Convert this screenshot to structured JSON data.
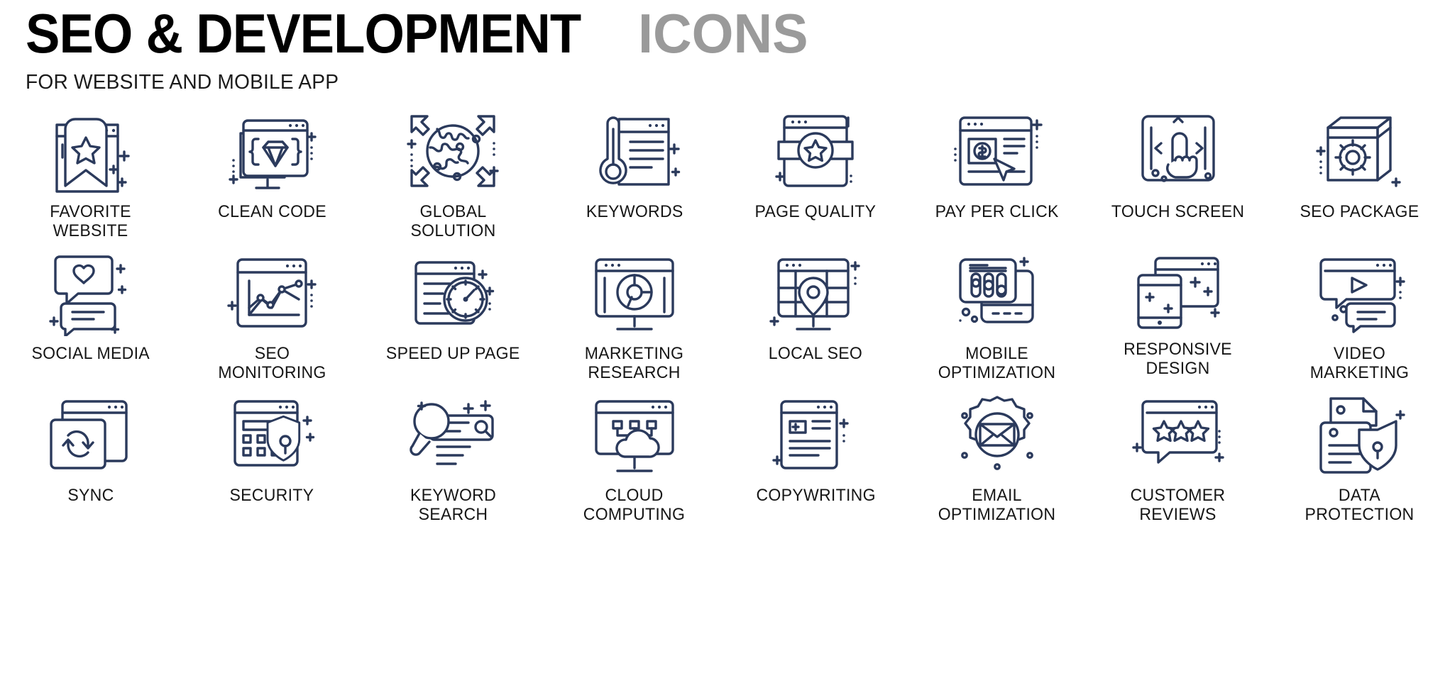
{
  "header": {
    "title_main": "SEO & DEVELOPMENT",
    "title_accent": "ICONS",
    "subtitle": "FOR WEBSITE AND MOBILE APP"
  },
  "colors": {
    "icon_stroke": "#2B3A5C",
    "title": "#000000",
    "title_accent": "#9A9A9A",
    "label": "#161616",
    "background": "#FFFFFF"
  },
  "grid": {
    "columns": 8,
    "rows": 3
  },
  "icons": [
    {
      "id": "favorite-website",
      "label": "FAVORITE WEBSITE",
      "row": 1,
      "col": 1
    },
    {
      "id": "clean-code",
      "label": "CLEAN CODE",
      "row": 1,
      "col": 2
    },
    {
      "id": "global-solution",
      "label": "GLOBAL SOLUTION",
      "row": 1,
      "col": 3
    },
    {
      "id": "keywords",
      "label": "KEYWORDS",
      "row": 1,
      "col": 4
    },
    {
      "id": "page-quality",
      "label": "PAGE QUALITY",
      "row": 1,
      "col": 5
    },
    {
      "id": "pay-per-click",
      "label": "PAY PER CLICK",
      "row": 1,
      "col": 6
    },
    {
      "id": "touch-screen",
      "label": "TOUCH SCREEN",
      "row": 1,
      "col": 7
    },
    {
      "id": "seo-package",
      "label": "SEO PACKAGE",
      "row": 1,
      "col": 8
    },
    {
      "id": "social-media",
      "label": "SOCIAL MEDIA",
      "row": 2,
      "col": 1
    },
    {
      "id": "seo-monitoring",
      "label": "SEO MONITORING",
      "row": 2,
      "col": 2
    },
    {
      "id": "speed-up-page",
      "label": "SPEED UP PAGE",
      "row": 2,
      "col": 3
    },
    {
      "id": "marketing-research",
      "label": "MARKETING RESEARCH",
      "row": 2,
      "col": 4
    },
    {
      "id": "local-seo",
      "label": "LOCAL SEO",
      "row": 2,
      "col": 5
    },
    {
      "id": "mobile-optimization",
      "label": "MOBILE OPTIMIZATION",
      "row": 2,
      "col": 6
    },
    {
      "id": "responsive-design",
      "label": "RESPONSIVE DESIGN",
      "row": 2,
      "col": 7
    },
    {
      "id": "video-marketing",
      "label": "VIDEO MARKETING",
      "row": 2,
      "col": 8
    },
    {
      "id": "sync",
      "label": "SYNC",
      "row": 3,
      "col": 1
    },
    {
      "id": "security",
      "label": "SECURITY",
      "row": 3,
      "col": 2
    },
    {
      "id": "keyword-search",
      "label": "KEYWORD SEARCH",
      "row": 3,
      "col": 3
    },
    {
      "id": "cloud-computing",
      "label": "CLOUD COMPUTING",
      "row": 3,
      "col": 4
    },
    {
      "id": "copywriting",
      "label": "COPYWRITING",
      "row": 3,
      "col": 5
    },
    {
      "id": "email-optimization",
      "label": "EMAIL OPTIMIZATION",
      "row": 3,
      "col": 6
    },
    {
      "id": "customer-reviews",
      "label": "CUSTOMER REVIEWS",
      "row": 3,
      "col": 7
    },
    {
      "id": "data-protection",
      "label": "DATA PROTECTION",
      "row": 3,
      "col": 8
    }
  ]
}
